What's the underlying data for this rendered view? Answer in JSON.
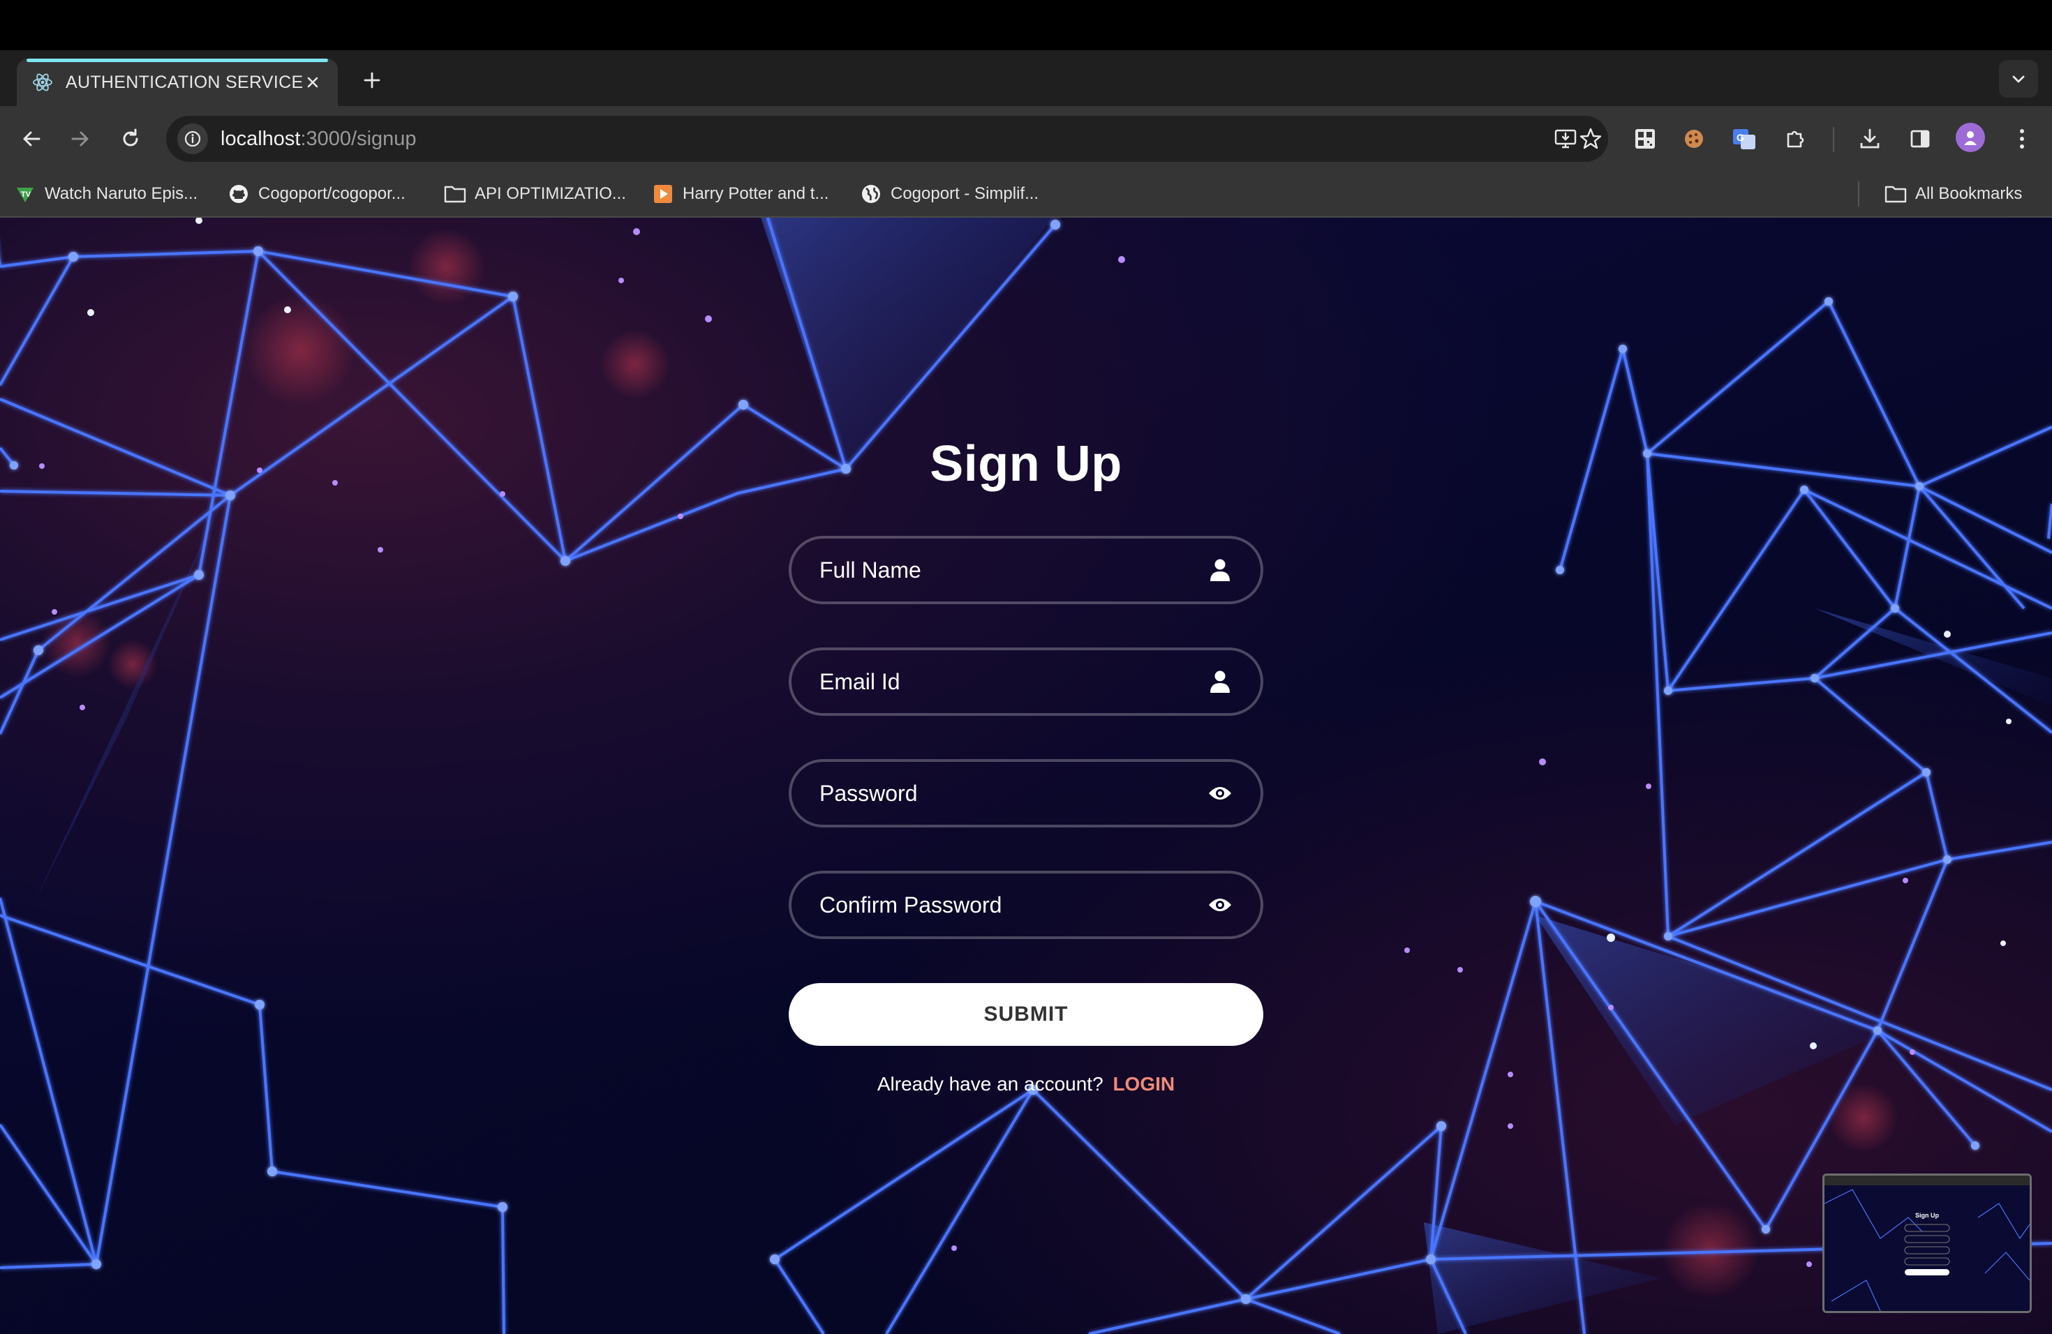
{
  "tab": {
    "title": "AUTHENTICATION SERVICE",
    "favicon": "react-atom-icon"
  },
  "omnibox": {
    "host": "localhost",
    "path": ":3000/signup"
  },
  "bookmarks": {
    "items": [
      {
        "label": "Watch Naruto Epis...",
        "icon": "tv-icon"
      },
      {
        "label": "Cogoport/cogopor...",
        "icon": "github-icon"
      },
      {
        "label": "API OPTIMIZATIO...",
        "icon": "folder-icon"
      },
      {
        "label": "Harry Potter and t...",
        "icon": "play-icon"
      },
      {
        "label": "Cogoport - Simplif...",
        "icon": "globe-icon"
      }
    ],
    "all_label": "All Bookmarks"
  },
  "signup": {
    "title": "Sign Up",
    "fields": [
      {
        "placeholder": "Full Name",
        "icon": "user-icon"
      },
      {
        "placeholder": "Email Id",
        "icon": "user-icon"
      },
      {
        "placeholder": "Password",
        "icon": "eye-icon"
      },
      {
        "placeholder": "Confirm Password",
        "icon": "eye-icon"
      }
    ],
    "submit_label": "SUBMIT",
    "switch_text": "Already have an account?",
    "switch_link": "LOGIN"
  },
  "colors": {
    "accent_link": "#f08a7b",
    "network_line": "#4a74ff",
    "background": "#07072a"
  }
}
